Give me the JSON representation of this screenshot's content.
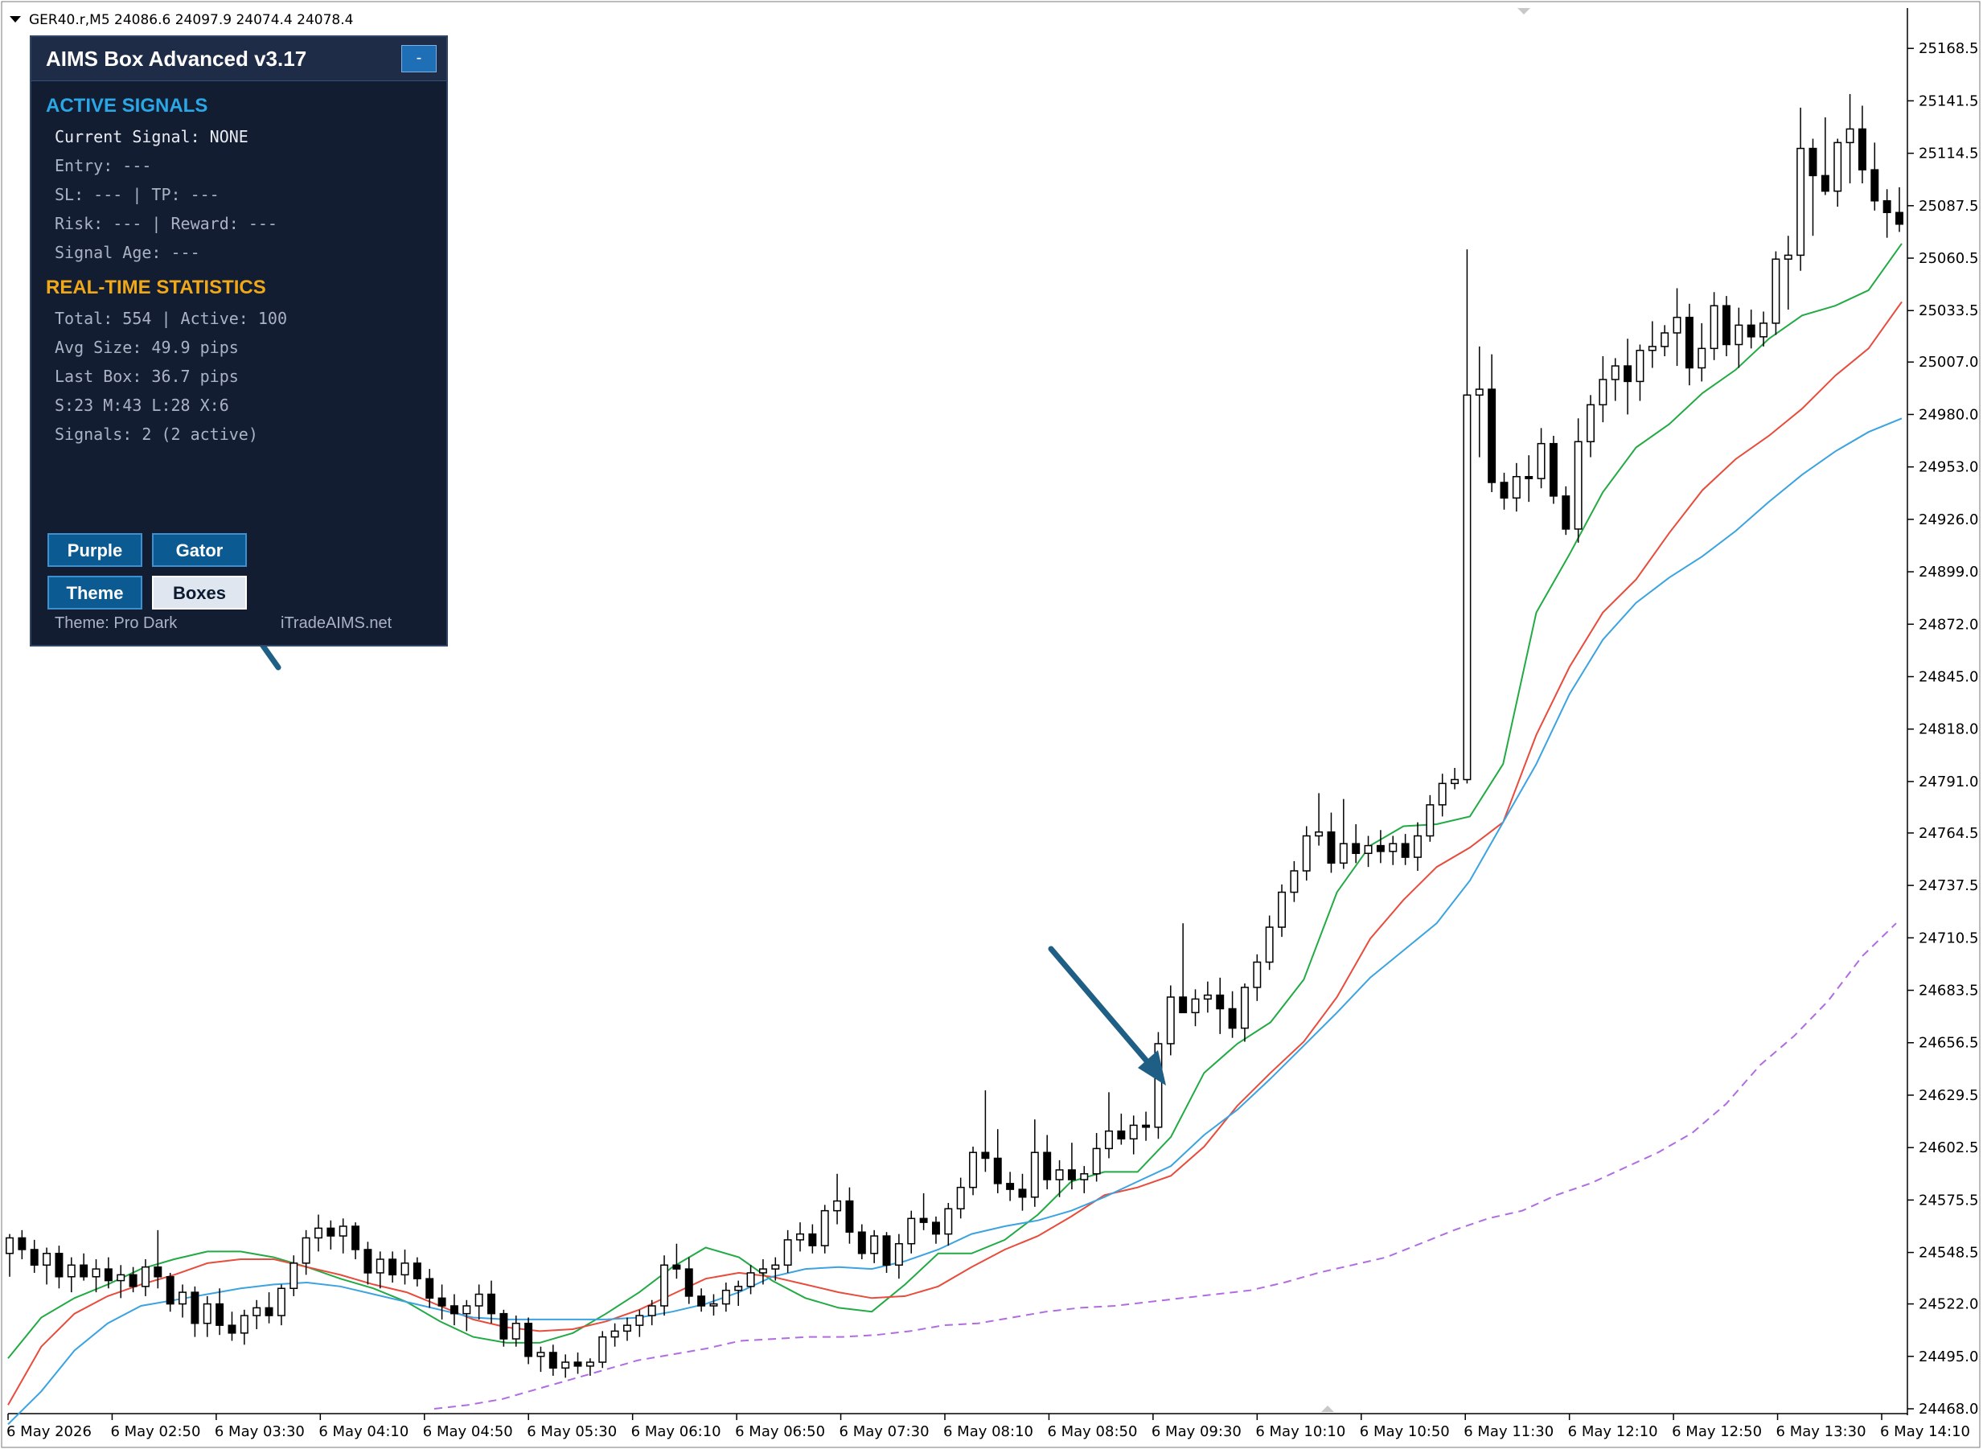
{
  "chart_header": "GER40.r,M5  24086.6 24097.9 24074.4 24078.4",
  "panel": {
    "title": "AIMS Box Advanced v3.17",
    "minimize_label": "-",
    "active_signals_header": "ACTIVE SIGNALS",
    "current_signal": "Current Signal: NONE",
    "entry": "Entry: ---",
    "sl_tp": "SL: ---  |  TP: ---",
    "risk_reward": "Risk: --- | Reward: ---",
    "signal_age": "Signal Age: ---",
    "stats_header": "REAL-TIME STATISTICS",
    "total_active": "Total: 554 | Active: 100",
    "avg_size": "Avg Size: 49.9 pips",
    "last_box": "Last Box: 36.7 pips",
    "sizes": "S:23 M:43 L:28 X:6",
    "signals": "Signals: 2 (2 active)",
    "buttons": {
      "purple": "Purple",
      "gator": "Gator",
      "theme": "Theme",
      "boxes": "Boxes"
    },
    "theme_label": "Theme: Pro Dark",
    "website": "iTradeAIMS.net",
    "colors": {
      "background": "#131d31",
      "active_header": "#2aa7e6",
      "stats_header": "#f0a818",
      "button": "#0c5a92"
    }
  },
  "chart_data": {
    "type": "candlestick",
    "symbol": "GER40.r",
    "timeframe": "M5",
    "ohlc_header": {
      "open": 24086.6,
      "high": 24097.9,
      "low": 24074.4,
      "close": 24078.4
    },
    "ylim": [
      24468.0,
      25181.0
    ],
    "y_ticks": [
      "25168.5",
      "25141.5",
      "25114.5",
      "25087.5",
      "25060.5",
      "25033.5",
      "25007.0",
      "24980.0",
      "24953.0",
      "24926.0",
      "24899.0",
      "24872.0",
      "24845.0",
      "24818.0",
      "24791.0",
      "24764.5",
      "24737.5",
      "24710.5",
      "24683.5",
      "24656.5",
      "24629.5",
      "24602.5",
      "24575.5",
      "24548.5",
      "24522.0",
      "24495.0",
      "24468.0"
    ],
    "x_ticks": [
      "6 May 2026",
      "6 May 02:50",
      "6 May 03:30",
      "6 May 04:10",
      "6 May 04:50",
      "6 May 05:30",
      "6 May 06:10",
      "6 May 06:50",
      "6 May 07:30",
      "6 May 08:10",
      "6 May 08:50",
      "6 May 09:30",
      "6 May 10:10",
      "6 May 10:50",
      "6 May 11:30",
      "6 May 12:10",
      "6 May 12:50",
      "6 May 13:30",
      "6 May 14:10"
    ],
    "candles": [
      [
        24548,
        24558,
        24536,
        24556
      ],
      [
        24556,
        24560,
        24545,
        24550
      ],
      [
        24550,
        24555,
        24538,
        24542
      ],
      [
        24542,
        24551,
        24532,
        24548
      ],
      [
        24548,
        24552,
        24530,
        24536
      ],
      [
        24536,
        24546,
        24528,
        24542
      ],
      [
        24542,
        24548,
        24534,
        24536
      ],
      [
        24536,
        24545,
        24528,
        24540
      ],
      [
        24540,
        24546,
        24530,
        24534
      ],
      [
        24534,
        24542,
        24525,
        24537
      ],
      [
        24537,
        24541,
        24528,
        24531
      ],
      [
        24531,
        24545,
        24526,
        24541
      ],
      [
        24541,
        24560,
        24530,
        24536
      ],
      [
        24536,
        24538,
        24518,
        24522
      ],
      [
        24522,
        24532,
        24515,
        24528
      ],
      [
        24528,
        24531,
        24505,
        24512
      ],
      [
        24512,
        24526,
        24505,
        24522
      ],
      [
        24522,
        24530,
        24506,
        24511
      ],
      [
        24511,
        24518,
        24503,
        24507
      ],
      [
        24507,
        24519,
        24501,
        24516
      ],
      [
        24516,
        24524,
        24509,
        24520
      ],
      [
        24520,
        24528,
        24512,
        24516
      ],
      [
        24516,
        24532,
        24511,
        24530
      ],
      [
        24530,
        24547,
        24526,
        24543
      ],
      [
        24543,
        24560,
        24537,
        24556
      ],
      [
        24556,
        24568,
        24549,
        24561
      ],
      [
        24561,
        24565,
        24550,
        24557
      ],
      [
        24557,
        24566,
        24548,
        24562
      ],
      [
        24562,
        24564,
        24545,
        24550
      ],
      [
        24550,
        24554,
        24532,
        24538
      ],
      [
        24538,
        24549,
        24530,
        24545
      ],
      [
        24545,
        24549,
        24533,
        24537
      ],
      [
        24537,
        24550,
        24532,
        24543
      ],
      [
        24543,
        24546,
        24531,
        24535
      ],
      [
        24535,
        24540,
        24520,
        24525
      ],
      [
        24525,
        24532,
        24514,
        24521
      ],
      [
        24521,
        24527,
        24511,
        24517
      ],
      [
        24517,
        24524,
        24508,
        24521
      ],
      [
        24521,
        24532,
        24514,
        24527
      ],
      [
        24527,
        24534,
        24512,
        24517
      ],
      [
        24517,
        24519,
        24500,
        24504
      ],
      [
        24504,
        24516,
        24500,
        24512
      ],
      [
        24512,
        24515,
        24491,
        24495
      ],
      [
        24495,
        24500,
        24487,
        24497
      ],
      [
        24497,
        24501,
        24485,
        24489
      ],
      [
        24489,
        24496,
        24484,
        24492
      ],
      [
        24492,
        24497,
        24486,
        24490
      ],
      [
        24490,
        24494,
        24485,
        24492
      ],
      [
        24492,
        24508,
        24489,
        24505
      ],
      [
        24505,
        24512,
        24500,
        24508
      ],
      [
        24508,
        24515,
        24503,
        24511
      ],
      [
        24511,
        24519,
        24505,
        24516
      ],
      [
        24516,
        24524,
        24511,
        24521
      ],
      [
        24521,
        24547,
        24516,
        24542
      ],
      [
        24542,
        24553,
        24535,
        24540
      ],
      [
        24540,
        24546,
        24522,
        24526
      ],
      [
        24526,
        24530,
        24518,
        24521
      ],
      [
        24521,
        24527,
        24516,
        24522
      ],
      [
        24522,
        24533,
        24518,
        24529
      ],
      [
        24529,
        24534,
        24521,
        24531
      ],
      [
        24531,
        24542,
        24527,
        24538
      ],
      [
        24538,
        24545,
        24532,
        24540
      ],
      [
        24540,
        24546,
        24534,
        24542
      ],
      [
        24542,
        24560,
        24538,
        24555
      ],
      [
        24555,
        24564,
        24549,
        24558
      ],
      [
        24558,
        24563,
        24548,
        24552
      ],
      [
        24552,
        24573,
        24548,
        24570
      ],
      [
        24570,
        24589,
        24563,
        24575
      ],
      [
        24575,
        24582,
        24553,
        24559
      ],
      [
        24559,
        24563,
        24545,
        24548
      ],
      [
        24548,
        24560,
        24543,
        24557
      ],
      [
        24557,
        24559,
        24538,
        24542
      ],
      [
        24542,
        24558,
        24535,
        24553
      ],
      [
        24553,
        24570,
        24548,
        24566
      ],
      [
        24566,
        24579,
        24560,
        24564
      ],
      [
        24564,
        24567,
        24553,
        24558
      ],
      [
        24558,
        24574,
        24552,
        24571
      ],
      [
        24571,
        24587,
        24566,
        24582
      ],
      [
        24582,
        24603,
        24578,
        24600
      ],
      [
        24600,
        24632,
        24590,
        24597
      ],
      [
        24597,
        24612,
        24579,
        24584
      ],
      [
        24584,
        24590,
        24575,
        24581
      ],
      [
        24581,
        24589,
        24570,
        24577
      ],
      [
        24577,
        24617,
        24572,
        24600
      ],
      [
        24600,
        24609,
        24581,
        24586
      ],
      [
        24586,
        24596,
        24577,
        24591
      ],
      [
        24591,
        24605,
        24581,
        24586
      ],
      [
        24586,
        24593,
        24579,
        24589
      ],
      [
        24589,
        24610,
        24585,
        24602
      ],
      [
        24602,
        24631,
        24597,
        24611
      ],
      [
        24611,
        24620,
        24604,
        24607
      ],
      [
        24607,
        24619,
        24599,
        24614
      ],
      [
        24614,
        24621,
        24606,
        24613
      ],
      [
        24613,
        24662,
        24607,
        24656
      ],
      [
        24656,
        24686,
        24650,
        24680
      ],
      [
        24680,
        24718,
        24674,
        24672
      ],
      [
        24672,
        24684,
        24665,
        24679
      ],
      [
        24679,
        24688,
        24672,
        24681
      ],
      [
        24681,
        24690,
        24661,
        24674
      ],
      [
        24674,
        24683,
        24659,
        24664
      ],
      [
        24664,
        24687,
        24657,
        24685
      ],
      [
        24685,
        24702,
        24678,
        24698
      ],
      [
        24698,
        24722,
        24694,
        24716
      ],
      [
        24716,
        24738,
        24711,
        24734
      ],
      [
        24734,
        24750,
        24729,
        24745
      ],
      [
        24745,
        24768,
        24740,
        24763
      ],
      [
        24763,
        24785,
        24758,
        24765
      ],
      [
        24765,
        24775,
        24744,
        24749
      ],
      [
        24749,
        24782,
        24746,
        24759
      ],
      [
        24759,
        24769,
        24749,
        24754
      ],
      [
        24754,
        24763,
        24747,
        24758
      ],
      [
        24758,
        24766,
        24749,
        24755
      ],
      [
        24755,
        24763,
        24748,
        24759
      ],
      [
        24759,
        24764,
        24748,
        24752
      ],
      [
        24752,
        24770,
        24745,
        24763
      ],
      [
        24763,
        24784,
        24760,
        24779
      ],
      [
        24779,
        24795,
        24773,
        24790
      ],
      [
        24790,
        24798,
        24787,
        24792
      ],
      [
        24792,
        25065,
        24790,
        24990
      ],
      [
        24990,
        25015,
        24958,
        24993
      ],
      [
        24993,
        25011,
        24940,
        24945
      ],
      [
        24945,
        24950,
        24931,
        24937
      ],
      [
        24937,
        24955,
        24930,
        24948
      ],
      [
        24948,
        24959,
        24935,
        24947
      ],
      [
        24947,
        24973,
        24942,
        24965
      ],
      [
        24965,
        24969,
        24934,
        24938
      ],
      [
        24938,
        24943,
        24918,
        24921
      ],
      [
        24921,
        24978,
        24914,
        24966
      ],
      [
        24966,
        24990,
        24958,
        24985
      ],
      [
        24985,
        25010,
        24976,
        24998
      ],
      [
        24998,
        25009,
        24987,
        25005
      ],
      [
        25005,
        25019,
        24980,
        24997
      ],
      [
        24997,
        25016,
        24987,
        25013
      ],
      [
        25013,
        25028,
        25004,
        25015
      ],
      [
        25015,
        25026,
        25010,
        25022
      ],
      [
        25022,
        25045,
        25005,
        25030
      ],
      [
        25030,
        25037,
        24995,
        25004
      ],
      [
        25004,
        25027,
        24997,
        25014
      ],
      [
        25014,
        25043,
        25008,
        25036
      ],
      [
        25036,
        25041,
        25010,
        25016
      ],
      [
        25016,
        25035,
        25004,
        25026
      ],
      [
        25026,
        25034,
        25014,
        25020
      ],
      [
        25020,
        25033,
        25015,
        25027
      ],
      [
        25027,
        25064,
        25021,
        25060
      ],
      [
        25060,
        25072,
        25034,
        25062
      ],
      [
        25062,
        25138,
        25054,
        25117
      ],
      [
        25117,
        25122,
        25072,
        25103
      ],
      [
        25103,
        25133,
        25093,
        25095
      ],
      [
        25095,
        25122,
        25087,
        25120
      ],
      [
        25120,
        25145,
        25099,
        25127
      ],
      [
        25127,
        25139,
        25099,
        25106
      ],
      [
        25106,
        25120,
        25085,
        25090
      ],
      [
        25090,
        25096,
        25071,
        25084
      ],
      [
        25084,
        25097,
        25074,
        25078
      ]
    ],
    "series": [
      {
        "name": "green",
        "color": "#22aa44",
        "values": [
          24494,
          24515,
          24525,
          24532,
          24540,
          24545,
          24549,
          24549,
          24546,
          24541,
          24535,
          24530,
          24523,
          24513,
          24505,
          24502,
          24502,
          24507,
          24517,
          24528,
          24541,
          24551,
          24546,
          24534,
          24525,
          24520,
          24518,
          24532,
          24548,
          24548,
          24555,
          24568,
          24585,
          24590,
          24590,
          24608,
          24641,
          24656,
          24667,
          24689,
          24734,
          24758,
          24768,
          24769,
          24773,
          24800,
          24878,
          24908,
          24940,
          24963,
          24975,
          24991,
          25003,
          25019,
          25031,
          25036,
          25044,
          25068
        ]
      },
      {
        "name": "red",
        "color": "#e74c3c",
        "values": [
          24470,
          24500,
          24517,
          24526,
          24532,
          24537,
          24543,
          24545,
          24545,
          24541,
          24537,
          24532,
          24528,
          24521,
          24514,
          24510,
          24508,
          24509,
          24513,
          24519,
          24527,
          24535,
          24538,
          24536,
          24532,
          24528,
          24525,
          24526,
          24531,
          24541,
          24550,
          24557,
          24567,
          24578,
          24582,
          24588,
          24603,
          24624,
          24641,
          24657,
          24680,
          24710,
          24730,
          24747,
          24757,
          24770,
          24815,
          24850,
          24878,
          24895,
          24919,
          24941,
          24957,
          24969,
          24983,
          25000,
          25014,
          25038
        ]
      },
      {
        "name": "blue",
        "color": "#3aa3e0",
        "values": [
          24460,
          24477,
          24498,
          24512,
          24521,
          24524,
          24527,
          24530,
          24532,
          24533,
          24531,
          24527,
          24523,
          24519,
          24515,
          24514,
          24514,
          24514,
          24514,
          24515,
          24518,
          24522,
          24528,
          24536,
          24540,
          24541,
          24540,
          24544,
          24550,
          24558,
          24562,
          24565,
          24570,
          24577,
          24585,
          24593,
          24609,
          24622,
          24638,
          24655,
          24672,
          24690,
          24704,
          24718,
          24740,
          24770,
          24800,
          24836,
          24864,
          24883,
          24896,
          24907,
          24920,
          24935,
          24949,
          24961,
          24971,
          24978
        ]
      },
      {
        "name": "purple",
        "color": "#b06ce0",
        "dashed": true,
        "values": [
          24468,
          24470,
          24473,
          24478,
          24483,
          24488,
          24493,
          24496,
          24499,
          24503,
          24504,
          24505,
          24505,
          24506,
          24508,
          24511,
          24512,
          24515,
          24518,
          24520,
          24521,
          24523,
          24525,
          24527,
          24529,
          24533,
          24538,
          24542,
          24546,
          24553,
          24560,
          24566,
          24570,
          24578,
          24584,
          24592,
          24600,
          24610,
          24625,
          24645,
          24660,
          24678,
          24701,
          24718
        ]
      }
    ]
  }
}
